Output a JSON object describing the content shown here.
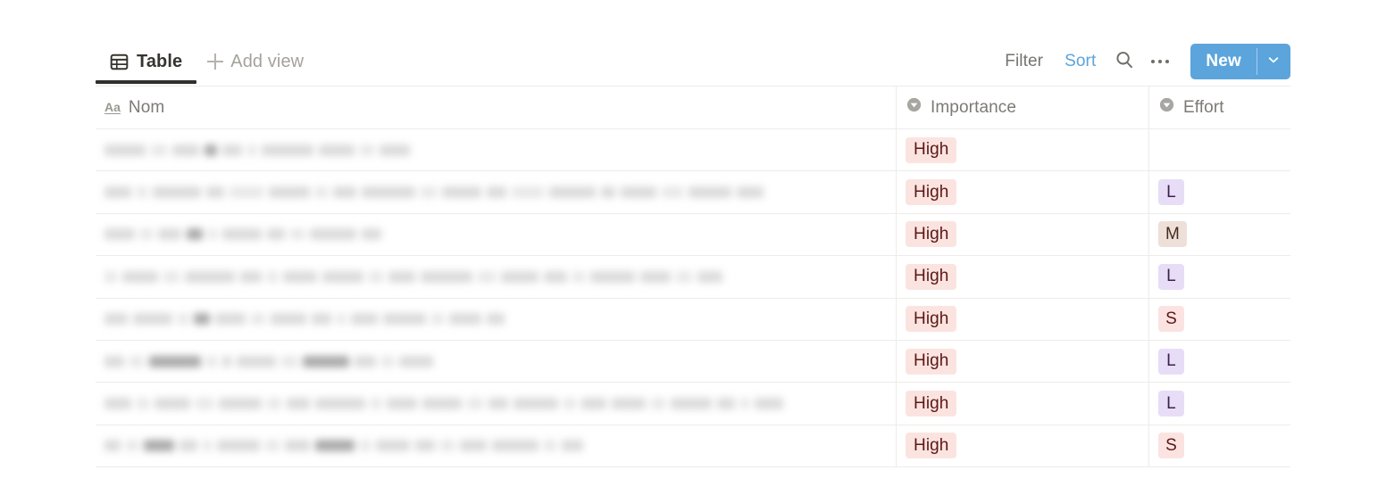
{
  "view_bar": {
    "tabs": [
      {
        "label": "Table",
        "icon": "table-icon",
        "active": true
      }
    ],
    "add_view_label": "Add view",
    "add_view_icon": "plus-icon",
    "actions": {
      "filter_label": "Filter",
      "sort_label": "Sort",
      "search_icon": "search-icon",
      "more_icon": "more-options-icon",
      "new_label": "New",
      "new_caret_icon": "chevron-down-icon"
    },
    "colors": {
      "accent": "#5ba4dc",
      "muted_text": "#75736e",
      "tab_underline": "#2f2f2c"
    }
  },
  "table": {
    "columns": [
      {
        "key": "name",
        "label": "Nom",
        "icon": "text-type-icon"
      },
      {
        "key": "importance",
        "label": "Importance",
        "icon": "select-type-icon"
      },
      {
        "key": "effort",
        "label": "Effort",
        "icon": "select-type-icon"
      }
    ],
    "rows": [
      {
        "name": "",
        "name_redacted": true,
        "importance": "High",
        "importance_tone": "tone-red",
        "effort": "",
        "effort_tone": ""
      },
      {
        "name": "",
        "name_redacted": true,
        "importance": "High",
        "importance_tone": "tone-red",
        "effort": "L",
        "effort_tone": "tone-purple"
      },
      {
        "name": "",
        "name_redacted": true,
        "importance": "High",
        "importance_tone": "tone-red",
        "effort": "M",
        "effort_tone": "tone-brown"
      },
      {
        "name": "",
        "name_redacted": true,
        "importance": "High",
        "importance_tone": "tone-red",
        "effort": "L",
        "effort_tone": "tone-purple"
      },
      {
        "name": "",
        "name_redacted": true,
        "importance": "High",
        "importance_tone": "tone-red",
        "effort": "S",
        "effort_tone": "tone-pink"
      },
      {
        "name": "",
        "name_redacted": true,
        "importance": "High",
        "importance_tone": "tone-red",
        "effort": "L",
        "effort_tone": "tone-purple"
      },
      {
        "name": "",
        "name_redacted": true,
        "importance": "High",
        "importance_tone": "tone-red",
        "effort": "L",
        "effort_tone": "tone-purple"
      },
      {
        "name": "",
        "name_redacted": true,
        "importance": "High",
        "importance_tone": "tone-red",
        "effort": "S",
        "effort_tone": "tone-pink"
      }
    ],
    "pill_colors": {
      "tone-red": {
        "bg": "#fbe4e0",
        "fg": "#5d1715"
      },
      "tone-purple": {
        "bg": "#e8ddf6",
        "fg": "#3b2150"
      },
      "tone-brown": {
        "bg": "#eee0d9",
        "fg": "#442a1e"
      },
      "tone-pink": {
        "bg": "#fbe3e1",
        "fg": "#5d1715"
      }
    }
  }
}
